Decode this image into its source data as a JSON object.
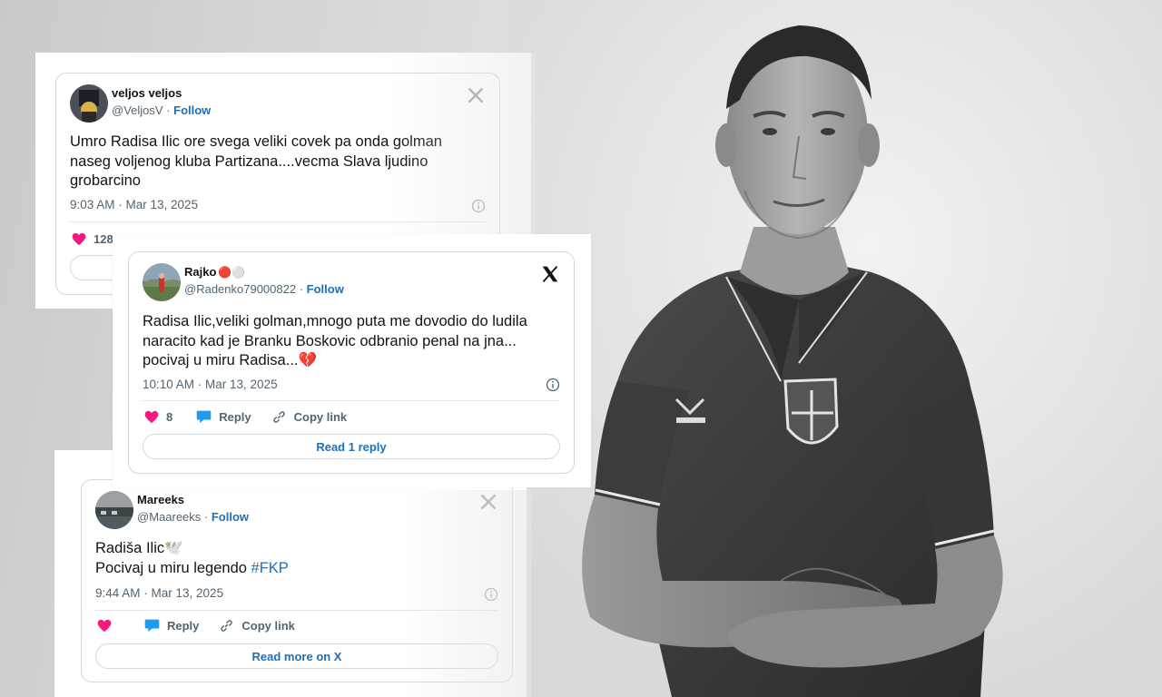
{
  "tweets": [
    {
      "name": "veljos veljos",
      "handle": "@VeljosV",
      "follow": "Follow",
      "text": "Umro Radisa Ilic ore svega veliki covek pa onda  golman naseg voljenog kluba Partizana....vecma Slava ljudino grobarcino",
      "time": "9:03 AM · Mar 13, 2025",
      "likes": "128"
    },
    {
      "name": "Rajko",
      "name_emoji": "🔴⚪",
      "handle": "@Radenko79000822",
      "follow": "Follow",
      "text_lines": [
        "Radisa Ilic,veliki golman,mnogo puta me dovodio do ludila",
        "naracito kad je Branku Boskovic odbranio penal na jna...",
        "pocivaj u miru Radisa..."
      ],
      "text_emoji": "💔",
      "time": "10:10 AM · Mar 13, 2025",
      "likes": "8",
      "reply_label": "Reply",
      "copy_label": "Copy link",
      "read_replies": "Read 1 reply"
    },
    {
      "name": "Mareeks",
      "handle": "@Maareeks",
      "follow": "Follow",
      "line1": "Radiša Ilic",
      "line1_emoji": "🕊️",
      "line2": "Pocivaj u miru legendo ",
      "hashtag": "#FKP",
      "time": "9:44 AM · Mar 13, 2025",
      "reply_label": "Reply",
      "copy_label": "Copy link",
      "read_more": "Read more on X"
    }
  ],
  "colors": {
    "link": "#1d6fb8",
    "heart": "#f91880",
    "text": "#0f1419",
    "muted": "#536471",
    "border": "#cfd9de"
  }
}
